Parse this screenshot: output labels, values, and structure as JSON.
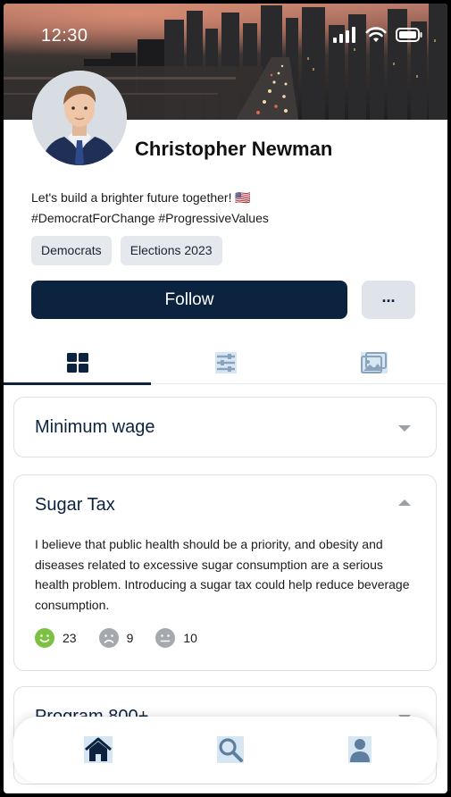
{
  "status_bar": {
    "time": "12:30"
  },
  "profile": {
    "name": "Christopher Newman",
    "bio_line1": "Let's build a brighter future together! 🇺🇸",
    "bio_line2": "#DemocratForChange #ProgressiveValues",
    "tags": [
      "Democrats",
      "Elections 2023"
    ]
  },
  "actions": {
    "follow_label": "Follow",
    "more_label": "..."
  },
  "tabs": [
    {
      "icon": "grid-icon",
      "active": true
    },
    {
      "icon": "sliders-icon",
      "active": false
    },
    {
      "icon": "gallery-icon",
      "active": false
    }
  ],
  "topics": [
    {
      "title": "Minimum wage",
      "expanded": false
    },
    {
      "title": "Sugar Tax",
      "expanded": true,
      "body": "I believe that public health should be a priority, and obesity and diseases related to excessive sugar consumption are a serious health problem. Introducing a sugar tax could help reduce beverage consumption.",
      "reactions": {
        "positive": "23",
        "negative": "9",
        "neutral": "10"
      }
    },
    {
      "title": "Program 800+",
      "expanded": false
    }
  ],
  "colors": {
    "primary": "#0c2340",
    "tag_bg": "#e5e8ec",
    "positive": "#7cc142",
    "neutral_gray": "#a5a9ae"
  },
  "bottom_nav": [
    "home-icon",
    "search-icon",
    "profile-icon"
  ]
}
